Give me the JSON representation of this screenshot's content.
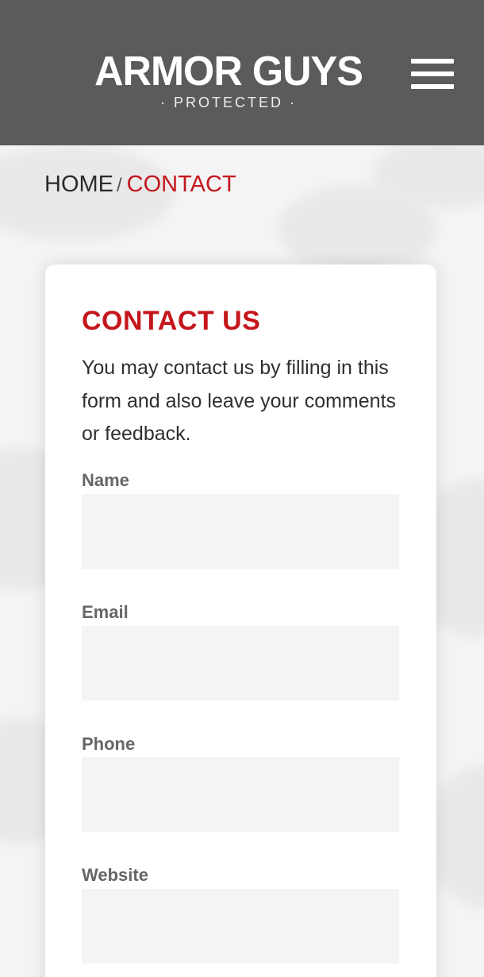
{
  "header": {
    "logo_main": "ARMOR GUYS",
    "logo_sub": "· PROTECTED ·",
    "menu_icon": "hamburger-menu-icon",
    "background_color": "#5b5b5b"
  },
  "breadcrumb": {
    "home": "HOME",
    "separator": "/",
    "current": "CONTACT",
    "accent_color": "#c4161c"
  },
  "contact_card": {
    "title": "CONTACT US",
    "description": "You may contact us by filling in this form and also leave your comments or feedback.",
    "fields": [
      {
        "label": "Name",
        "value": "",
        "placeholder": ""
      },
      {
        "label": "Email",
        "value": "",
        "placeholder": ""
      },
      {
        "label": "Phone",
        "value": "",
        "placeholder": ""
      },
      {
        "label": "Website",
        "value": "",
        "placeholder": ""
      }
    ]
  }
}
